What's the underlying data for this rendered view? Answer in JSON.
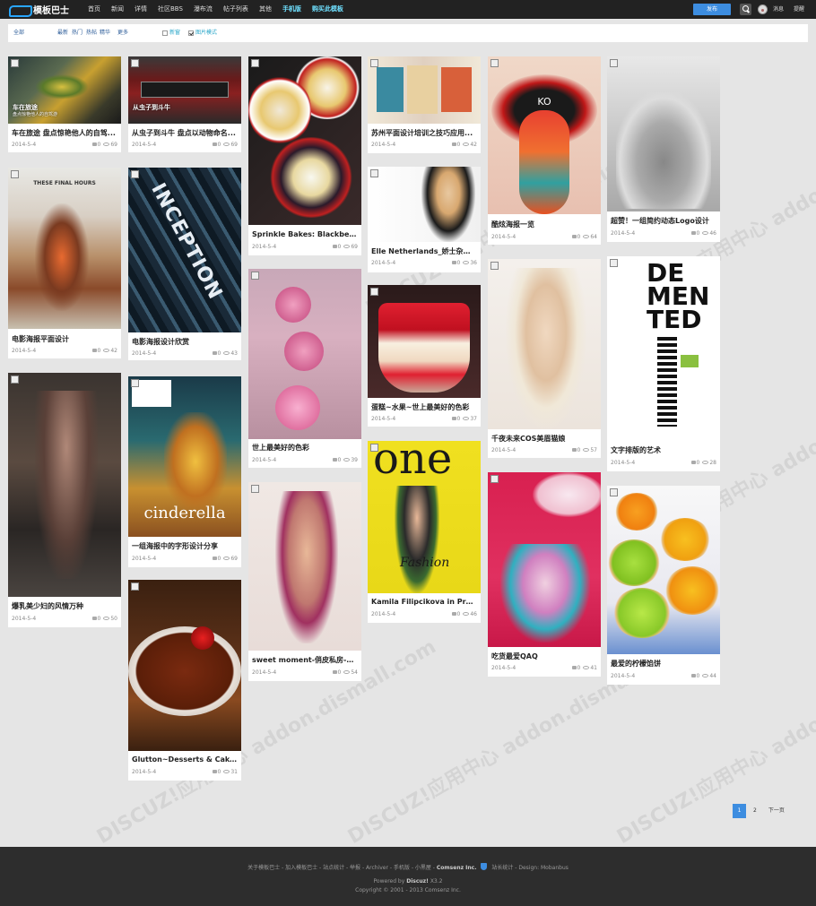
{
  "header": {
    "logo_text": "模板巴士",
    "nav": [
      "首页",
      "新闻",
      "详情",
      "社区BBS",
      "瀑布流",
      "帖子列表",
      "其他",
      "手机版",
      "购买此模板"
    ],
    "publish": "发布",
    "messages": "消息",
    "remind": "提醒",
    "colors": {
      "bar": "#222222",
      "accent": "#6fe0ff",
      "publish": "#3d8de0"
    }
  },
  "filters": {
    "all": "全部",
    "sort": [
      "最新",
      "热门",
      "热帖",
      "精华"
    ],
    "more": "更多",
    "new_window": "新窗",
    "image_mode": "图片模式",
    "image_mode_checked": true,
    "new_window_checked": false
  },
  "posts": [
    {
      "title": "车在旅途 盘点惊艳他人的自驾...",
      "caption": "车在旅途\n盘点惊艳他人的自驾游",
      "date": "2014-5-4",
      "replies": "0",
      "views": "69"
    },
    {
      "title": "从虫子到斗牛 盘点以动物命名...",
      "caption": "从虫子到斗牛",
      "date": "2014-5-4",
      "replies": "0",
      "views": "69"
    },
    {
      "title": "Sprinkle Bakes: Blackberry ...",
      "date": "2014-5-4",
      "replies": "0",
      "views": "69"
    },
    {
      "title": "苏州平面设计培训之技巧应用...",
      "date": "2014-5-4",
      "replies": "0",
      "views": "42"
    },
    {
      "title": "酷炫海报一览",
      "date": "2014-5-4",
      "replies": "0",
      "views": "64"
    },
    {
      "title": "超赞！一组简约动态Logo设计",
      "date": "2014-5-4",
      "replies": "0",
      "views": "46"
    },
    {
      "title": "电影海报平面设计",
      "date": "2014-5-4",
      "replies": "0",
      "views": "42"
    },
    {
      "title": "电影海报设计欣赏",
      "date": "2014-5-4",
      "replies": "0",
      "views": "43"
    },
    {
      "title": "Elle Netherlands_娇士杂志在线",
      "date": "2014-5-4",
      "replies": "0",
      "views": "36"
    },
    {
      "title": "世上最美好的色彩",
      "date": "2014-5-4",
      "replies": "0",
      "views": "39"
    },
    {
      "title": "蛋糕~水果~世上最美好的色彩",
      "date": "2014-5-4",
      "replies": "0",
      "views": "37"
    },
    {
      "title": "千夜未来COS美眉猫娘",
      "date": "2014-5-4",
      "replies": "0",
      "views": "57"
    },
    {
      "title": "文字排版的艺术",
      "date": "2014-5-4",
      "replies": "0",
      "views": "28"
    },
    {
      "title": "爆乳美少妇的风情万种",
      "date": "2014-5-4",
      "replies": "0",
      "views": "50"
    },
    {
      "title": "一组海报中的字形设计分享",
      "date": "2014-5-4",
      "replies": "0",
      "views": "69"
    },
    {
      "title": "Kamila Filipcikova in Prada ...",
      "date": "2014-5-4",
      "replies": "0",
      "views": "46"
    },
    {
      "title": "sweet moment-俏皮私房-美...",
      "date": "2014-5-4",
      "replies": "0",
      "views": "54"
    },
    {
      "title": "吃货最爱QAQ",
      "date": "2014-5-4",
      "replies": "0",
      "views": "41"
    },
    {
      "title": "最爱的柠檬馅饼",
      "date": "2014-5-4",
      "replies": "0",
      "views": "44"
    },
    {
      "title": "Glutton~Desserts & Cakes",
      "date": "2014-5-4",
      "replies": "0",
      "views": "31"
    }
  ],
  "poster_text": {
    "final_hours": "THESE FINAL HOURS",
    "inception": "INCEPTION",
    "cinderella": "cinderella",
    "one": "one",
    "fashion": "Fashion",
    "ko": "KO",
    "demented": [
      "DE",
      "MEN",
      "TED"
    ]
  },
  "watermark": "DISCUZ!应用中心 addon.dismall.com",
  "pager": {
    "pages": [
      "1",
      "2"
    ],
    "current": "1",
    "next": "下一页"
  },
  "footer": {
    "links": "关于模板巴士 - 加入模板巴士 - 站点统计 - 举报 - Archiver - 手机版 - 小黑屋 -",
    "company": "Comsenz Inc.",
    "links2": "站长统计 - Design: Mobanbus",
    "powered_label": "Powered by",
    "powered": "Discuz!",
    "version": "X3.2",
    "copyright": "Copyright © 2001 - 2013 Comsenz Inc."
  }
}
